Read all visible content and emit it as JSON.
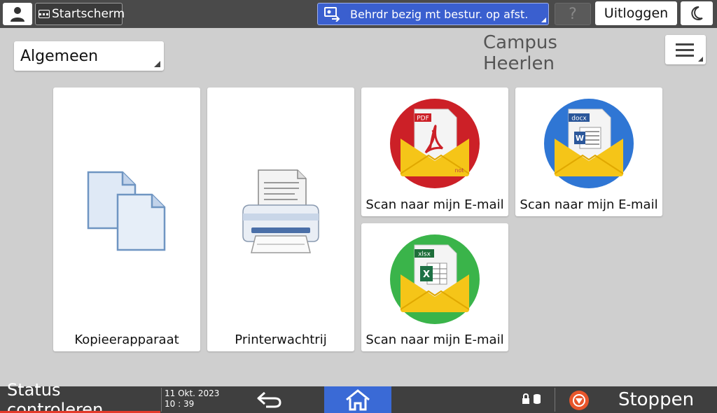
{
  "topbar": {
    "home_label": "Startscherm",
    "remote_label": "Behrdr bezig mt bestur. op afst.",
    "help_label": "?",
    "logout_label": "Uitloggen"
  },
  "header": {
    "category": "Algemeen",
    "location": "Campus Heerlen"
  },
  "tiles": [
    {
      "label": "Kopieerapparaat"
    },
    {
      "label": "Printerwachtrij"
    },
    {
      "label": "Scan naar mijn E-mail",
      "badge": "PDF",
      "tag": "not"
    },
    {
      "label": "Scan naar mijn E-mail",
      "badge": "docx"
    },
    {
      "label": "Scan naar mijn E-mail",
      "badge": "xlsx"
    }
  ],
  "bottombar": {
    "status_label": "Status controleren",
    "date": "11 Okt. 2023",
    "time": "10 : 39",
    "stop_label": "Stoppen"
  },
  "colors": {
    "pdf_red": "#cc2027",
    "docx_blue": "#2f76d4",
    "xlsx_green": "#3ab44a",
    "envelope_yellow": "#f5c518",
    "home_blue": "#3a6ad6",
    "stop_orange": "#e8562b"
  }
}
